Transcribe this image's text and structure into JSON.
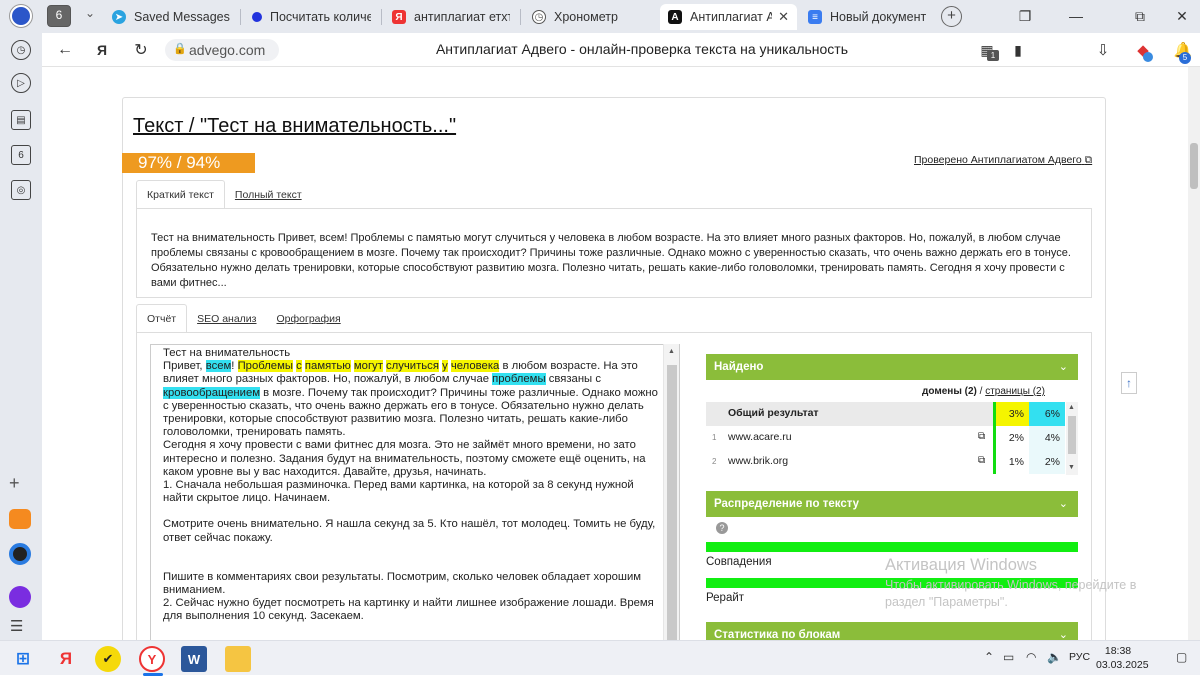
{
  "browser": {
    "tabs": [
      {
        "label": "Saved Messages",
        "icon": "telegram-icon",
        "color": "#2aa3e0"
      },
      {
        "label": "Посчитать количе",
        "icon": "blue-dot-icon",
        "color": "#2233dd"
      },
      {
        "label": "антиплагиат етхт",
        "icon": "yandex-icon",
        "color": "#e33"
      },
      {
        "label": "Хронометр",
        "icon": "stopwatch-icon",
        "color": "#555"
      },
      {
        "label": "Антиплагиат Ад",
        "icon": "advego-icon",
        "color": "#111"
      },
      {
        "label": "Новый документ -",
        "icon": "docs-icon",
        "color": "#3a7cf0"
      }
    ],
    "tab_count": "6",
    "url": "advego.com",
    "page_title": "Антиплагиат Адвего - онлайн-проверка текста на уникальность",
    "ext_badge": "1",
    "profile_badge": "5"
  },
  "page": {
    "heading": "Текст / \"Тест на внимательность...\"",
    "score": "97% / 94%",
    "verified": "Проверено Антиплагиатом Адвего",
    "tabs_top": [
      "Краткий текст",
      "Полный текст"
    ],
    "brief_text": "Тест на внимательность Привет, всем! Проблемы с памятью могут случиться у человека в любом возрасте. На это влияет много разных факторов. Но, пожалуй, в любом случае проблемы связаны с кровообращением в мозге. Почему так происходит? Причины тоже различные. Однако можно с уверенностью сказать, что очень важно держать его в тонусе. Обязательно нужно делать тренировки, которые способствуют развитию мозга. Полезно читать, решать какие-либо головоломки, тренировать память. Сегодня я хочу провести с вами фитнес...",
    "tabs_report": [
      "Отчёт",
      "SEO анализ",
      "Орфография"
    ],
    "report_text": {
      "line1": "Тест на внимательность",
      "seg": [
        "Привет, ",
        "всем",
        "! ",
        "Проблемы",
        " ",
        "с",
        " ",
        "памятью",
        " ",
        "могут",
        " ",
        "случиться",
        " ",
        "у",
        " ",
        "человека",
        " в любом возрасте. На это влияет много разных факторов. Но, пожалуй, в любом случае ",
        "проблемы",
        " связаны с ",
        "кровообращением",
        " в мозге. Почему так происходит? Причины тоже различные. Однако можно с уверенностью сказать, что очень важно держать его в тонусе. Обязательно нужно делать тренировки, которые способствуют развитию мозга. Полезно читать, решать какие-либо головоломки, тренировать память."
      ],
      "p2": "Сегодня я хочу провести с вами фитнес для мозга. Это не займёт много времени, но зато интересно и полезно. Задания будут на внимательность, поэтому сможете ещё оценить, на каком уровне вы у вас находится. Давайте, друзья, начинать.",
      "p3": "1.   Сначала небольшая разминочка. Перед вами картинка, на которой за 8 секунд нужной найти скрытое лицо. Начинаем.",
      "p4": "Смотрите очень внимательно. Я нашла секунд за 5. Кто нашёл, тот молодец. Томить не буду, ответ сейчас покажу.",
      "p5": "Пишите в комментариях свои результаты. Посмотрим, сколько человек обладает хорошим вниманием.",
      "p6": "2.   Сейчас нужно будет посмотреть на картинку и найти лишнее изображение лошади. Время для выполнения 10 секунд. Засекаем."
    },
    "found_title": "Найдено",
    "domains_label": "домены (2)",
    "pages_sep": " / ",
    "pages_label": "страницы (2)",
    "results": [
      {
        "n": "",
        "domain": "Общий результат",
        "a": "3%",
        "b": "6%",
        "bold": true
      },
      {
        "n": "1",
        "domain": "www.acare.ru",
        "a": "2%",
        "b": "4%"
      },
      {
        "n": "2",
        "domain": "www.brik.org",
        "a": "1%",
        "b": "2%"
      }
    ],
    "dist_title": "Распределение по тексту",
    "q": "?",
    "matches_label": "Совпадения",
    "rewrite_label": "Рерайт",
    "stats_title": "Статистика по блокам",
    "watermark_title": "Активация Windows",
    "watermark_text": "Чтобы активировать Windows, перейдите в раздел \"Параметры\"."
  },
  "taskbar": {
    "lang": "РУС",
    "time": "18:38",
    "date": "03.03.2025"
  },
  "colors": {
    "accent_green": "#8bbd3a",
    "score_orange": "#ee9a20",
    "highlight": "#33e0f0",
    "match_yellow": "#f5f500"
  }
}
